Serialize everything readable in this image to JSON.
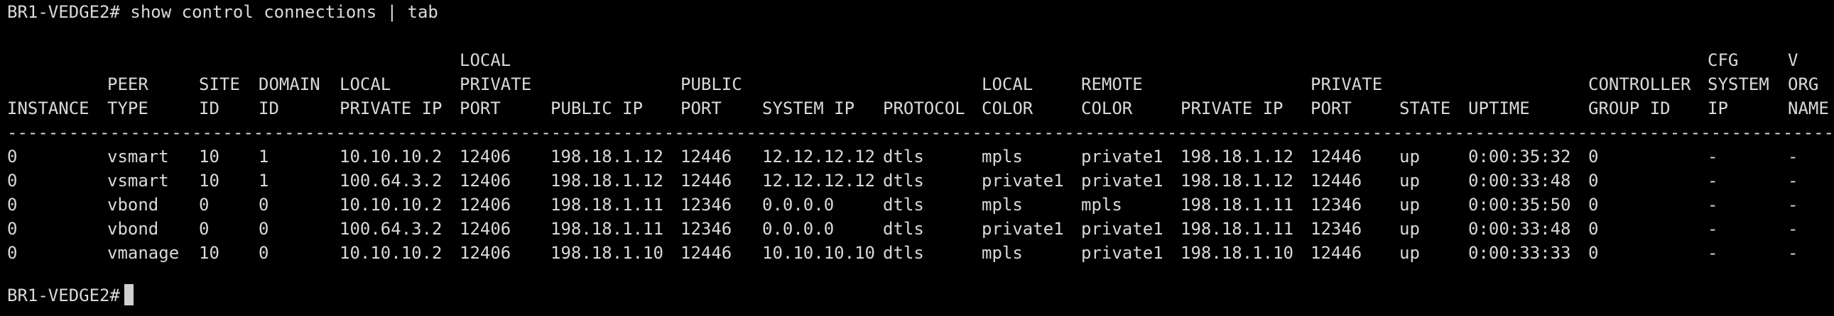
{
  "terminal": {
    "command_line": "BR1-VEDGE2# show control connections | tab",
    "prompt": "BR1-VEDGE2#",
    "separator": "----------------------------------------------------------------------------------------------------------------------------------------------------------------------------------------------------------------------------------------------------------------------------------"
  },
  "table": {
    "columns": [
      {
        "key": "instance",
        "label_lines": [
          "",
          "",
          "INSTANCE"
        ]
      },
      {
        "key": "peer_type",
        "label_lines": [
          "",
          "PEER",
          "TYPE"
        ]
      },
      {
        "key": "site_id",
        "label_lines": [
          "",
          "SITE",
          "ID"
        ]
      },
      {
        "key": "domain_id",
        "label_lines": [
          "",
          "DOMAIN",
          "ID"
        ]
      },
      {
        "key": "local_private_ip",
        "label_lines": [
          "",
          "LOCAL",
          "PRIVATE IP"
        ]
      },
      {
        "key": "local_private_port",
        "label_lines": [
          "LOCAL",
          "PRIVATE",
          "PORT"
        ]
      },
      {
        "key": "public_ip",
        "label_lines": [
          "",
          "",
          "PUBLIC IP"
        ]
      },
      {
        "key": "public_port",
        "label_lines": [
          "",
          "PUBLIC",
          "PORT"
        ]
      },
      {
        "key": "system_ip",
        "label_lines": [
          "",
          "",
          "SYSTEM IP"
        ]
      },
      {
        "key": "protocol",
        "label_lines": [
          "",
          "",
          "PROTOCOL"
        ]
      },
      {
        "key": "local_color",
        "label_lines": [
          "",
          "LOCAL",
          "COLOR"
        ]
      },
      {
        "key": "remote_color",
        "label_lines": [
          "",
          "REMOTE",
          "COLOR"
        ]
      },
      {
        "key": "private_ip",
        "label_lines": [
          "",
          "",
          "PRIVATE IP"
        ]
      },
      {
        "key": "private_port",
        "label_lines": [
          "",
          "PRIVATE",
          "PORT"
        ]
      },
      {
        "key": "state",
        "label_lines": [
          "",
          "",
          "STATE"
        ]
      },
      {
        "key": "uptime",
        "label_lines": [
          "",
          "",
          "UPTIME"
        ]
      },
      {
        "key": "controller_group_id",
        "label_lines": [
          "",
          "CONTROLLER",
          "GROUP ID"
        ]
      },
      {
        "key": "cfg_system_ip",
        "label_lines": [
          "CFG",
          "SYSTEM",
          "IP"
        ]
      },
      {
        "key": "v_org_name",
        "label_lines": [
          "V",
          "ORG",
          "NAME"
        ]
      }
    ],
    "rows": [
      [
        "0",
        "vsmart",
        "10",
        "1",
        "10.10.10.2",
        "12406",
        "198.18.1.12",
        "12446",
        "12.12.12.12",
        "dtls",
        "mpls",
        "private1",
        "198.18.1.12",
        "12446",
        "up",
        "0:00:35:32",
        "0",
        "-",
        "-"
      ],
      [
        "0",
        "vsmart",
        "10",
        "1",
        "100.64.3.2",
        "12406",
        "198.18.1.12",
        "12446",
        "12.12.12.12",
        "dtls",
        "private1",
        "private1",
        "198.18.1.12",
        "12446",
        "up",
        "0:00:33:48",
        "0",
        "-",
        "-"
      ],
      [
        "0",
        "vbond",
        "0",
        "0",
        "10.10.10.2",
        "12406",
        "198.18.1.11",
        "12346",
        "0.0.0.0",
        "dtls",
        "mpls",
        "mpls",
        "198.18.1.11",
        "12346",
        "up",
        "0:00:35:50",
        "0",
        "-",
        "-"
      ],
      [
        "0",
        "vbond",
        "0",
        "0",
        "100.64.3.2",
        "12406",
        "198.18.1.11",
        "12346",
        "0.0.0.0",
        "dtls",
        "private1",
        "private1",
        "198.18.1.11",
        "12346",
        "up",
        "0:00:33:48",
        "0",
        "-",
        "-"
      ],
      [
        "0",
        "vmanage",
        "10",
        "0",
        "10.10.10.2",
        "12406",
        "198.18.1.10",
        "12446",
        "10.10.10.10",
        "dtls",
        "mpls",
        "private1",
        "198.18.1.10",
        "12446",
        "up",
        "0:00:33:33",
        "0",
        "-",
        "-"
      ]
    ]
  }
}
